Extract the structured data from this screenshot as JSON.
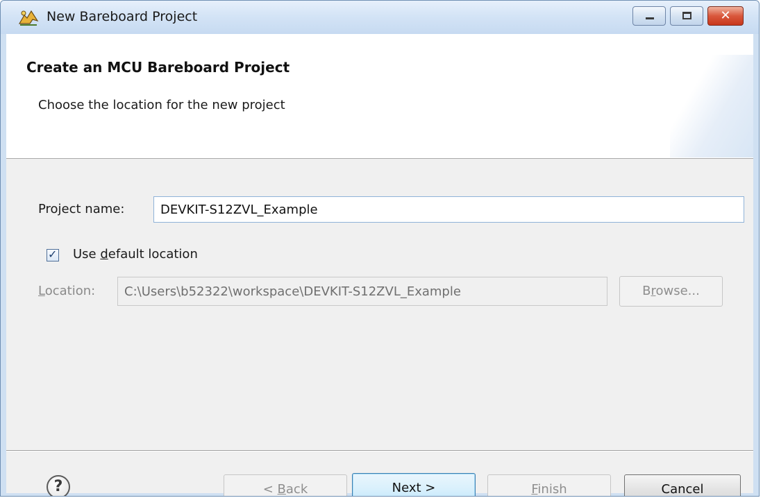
{
  "window": {
    "title": "New Bareboard Project",
    "app_icon": "bareboard-wizard-icon",
    "controls": {
      "minimize": "minimize-icon",
      "maximize": "maximize-icon",
      "close": "close-icon"
    }
  },
  "banner": {
    "title": "Create an MCU Bareboard Project",
    "description": "Choose the location for the new project"
  },
  "form": {
    "project_name_label": "Project name:",
    "project_name_value": "DEVKIT-S12ZVL_Example",
    "use_default_location": {
      "checked": true,
      "label_before": "Use ",
      "label_mnemonic": "d",
      "label_after": "efault location"
    },
    "location": {
      "label_mnemonic": "L",
      "label_after": "ocation:",
      "value": "C:\\Users\\b52322\\workspace\\DEVKIT-S12ZVL_Example",
      "enabled": false
    },
    "browse": {
      "label_before": "B",
      "label_mnemonic": "r",
      "label_after": "owse...",
      "enabled": false
    }
  },
  "footer": {
    "help_icon": "help-icon",
    "back": {
      "label_before": "< ",
      "label_mnemonic": "B",
      "label_after": "ack",
      "enabled": false
    },
    "next": {
      "label": "Next >",
      "enabled": true,
      "default": true
    },
    "finish": {
      "label_mnemonic": "F",
      "label_after": "inish",
      "enabled": false
    },
    "cancel": {
      "label": "Cancel",
      "enabled": true
    }
  },
  "colors": {
    "titlebar": "#d4e4f6",
    "close_button": "#d9573c",
    "dialog_background": "#f0f0f0",
    "default_button_border": "#3c7fb1"
  }
}
